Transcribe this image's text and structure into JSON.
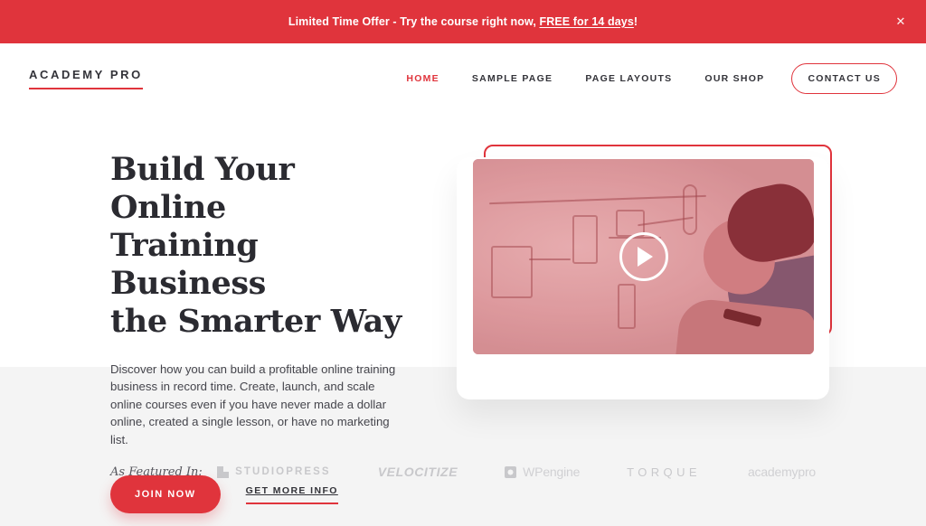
{
  "promo": {
    "text_before": "Limited Time Offer - Try the course right now, ",
    "link_text": "FREE for 14 days",
    "text_after": "!",
    "close_icon": "close-icon",
    "close_glyph": "✕",
    "background": "#e0343c"
  },
  "header": {
    "logo": "ACADEMY PRO",
    "nav": [
      {
        "label": "HOME",
        "active": true
      },
      {
        "label": "SAMPLE PAGE",
        "active": false
      },
      {
        "label": "PAGE LAYOUTS",
        "active": false
      },
      {
        "label": "OUR SHOP",
        "active": false
      }
    ],
    "cta": "CONTACT US"
  },
  "hero": {
    "title_line_1": "Build Your Online",
    "title_line_2": "Training Business",
    "title_line_3": "the Smarter Way",
    "paragraph": "Discover how you can build a profitable online training business in record time. Create, launch, and scale online courses even if you have never made a dollar online, created a single lesson, or have no marketing list.",
    "primary_button": "JOIN NOW",
    "secondary_link": "GET MORE INFO",
    "video": {
      "play_icon": "play-icon",
      "alt": "person writing a flowchart on a whiteboard"
    }
  },
  "featured": {
    "label": "As Featured In:",
    "brands": [
      {
        "name": "STUDIOPRESS",
        "mark": "studiopress-mark-icon"
      },
      {
        "name": "VELOCITIZE",
        "mark": ""
      },
      {
        "name": "WP",
        "suffix": "engine",
        "mark": "wpengine-mark-icon"
      },
      {
        "name": "TORQUE",
        "mark": ""
      },
      {
        "name": "academy",
        "suffix": "pro",
        "mark": ""
      }
    ]
  },
  "colors": {
    "accent": "#e0343c",
    "text": "#333339",
    "muted": "#8d8d93",
    "band": "#f4f4f4"
  }
}
